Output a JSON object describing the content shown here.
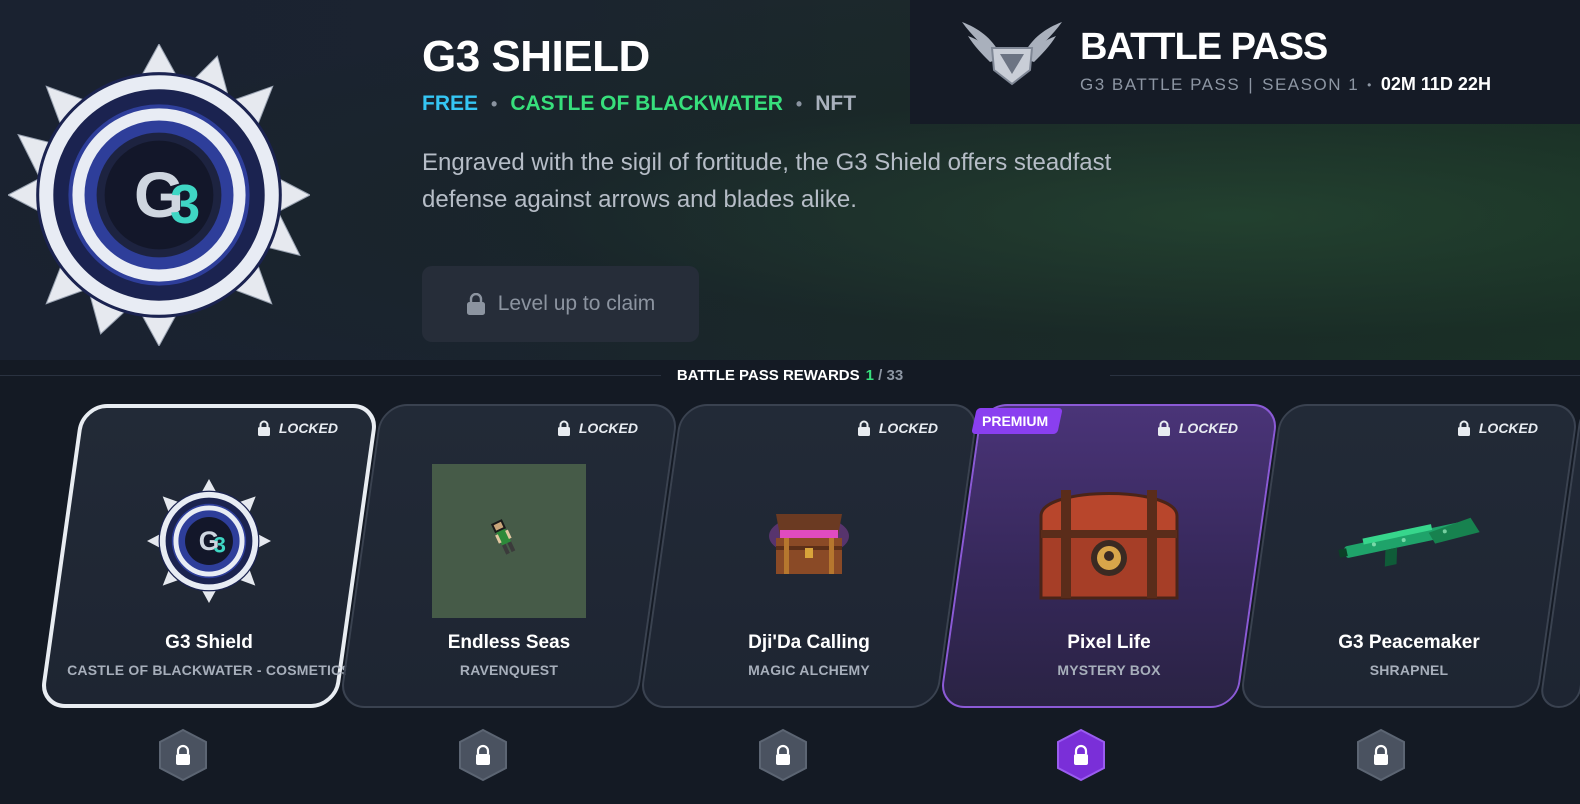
{
  "hero": {
    "title": "G3 SHIELD",
    "tag_free": "FREE",
    "tag_collection": "CASTLE OF BLACKWATER",
    "tag_type": "NFT",
    "description": "Engraved with the sigil of fortitude, the G3 Shield offers steadfast defense against arrows and blades alike.",
    "claim_label": "Level up to claim"
  },
  "battle_pass": {
    "title": "BATTLE PASS",
    "pass_name": "G3 BATTLE PASS",
    "season": "SEASON 1",
    "time_left": "02M 11D 22H"
  },
  "rewards": {
    "label": "BATTLE PASS REWARDS",
    "current": "1",
    "separator": "/",
    "total": "33",
    "items": [
      {
        "name": "G3 Shield",
        "collection": "CASTLE OF BLACKWATER - COSMETICS",
        "status": "LOCKED",
        "premium": false,
        "selected": true,
        "icon": "shield-icon"
      },
      {
        "name": "Endless Seas",
        "collection": "RAVENQUEST",
        "status": "LOCKED",
        "premium": false,
        "selected": false,
        "icon": "pixel-character-icon"
      },
      {
        "name": "Dji'Da Calling",
        "collection": "MAGIC ALCHEMY",
        "status": "LOCKED",
        "premium": false,
        "selected": false,
        "icon": "open-chest-icon"
      },
      {
        "name": "Pixel Life",
        "collection": "MYSTERY BOX",
        "status": "LOCKED",
        "premium": true,
        "premium_label": "PREMIUM",
        "selected": false,
        "icon": "treasure-chest-icon"
      },
      {
        "name": "G3 Peacemaker",
        "collection": "SHRAPNEL",
        "status": "LOCKED",
        "premium": false,
        "selected": false,
        "icon": "shotgun-icon"
      }
    ]
  },
  "colors": {
    "free": "#35c6f4",
    "collection": "#37df7c",
    "premium": "#8a3ff0",
    "progress_current": "#37df7c"
  }
}
